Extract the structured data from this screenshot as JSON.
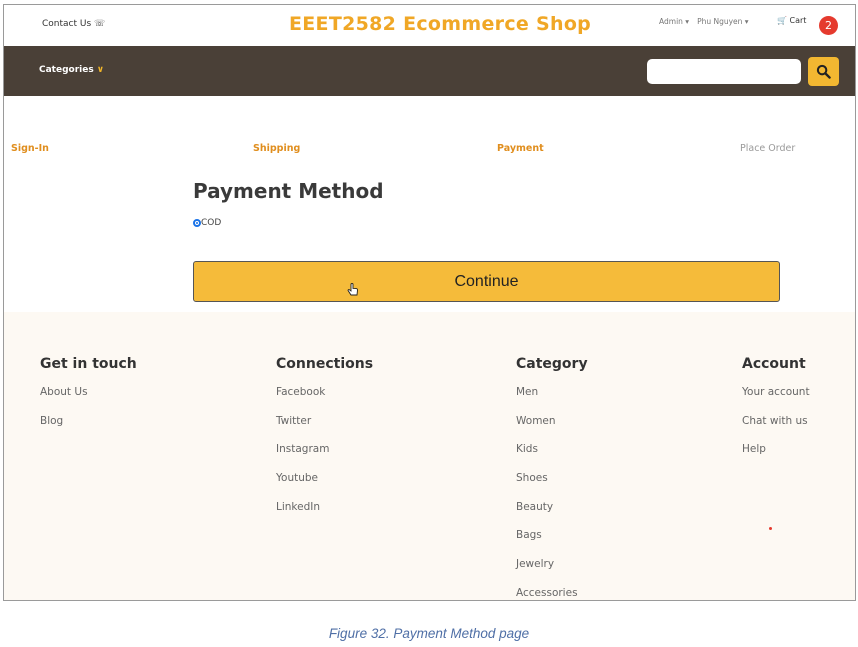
{
  "header": {
    "contact": "Contact Us",
    "brand": "EEET2582 Ecommerce Shop",
    "admin": "Admin",
    "user": "Phu Nguyen",
    "cart_label": "Cart",
    "cart_count": "2"
  },
  "nav": {
    "categories": "Categories",
    "search_placeholder": ""
  },
  "steps": [
    "Sign-In",
    "Shipping",
    "Payment",
    "Place Order"
  ],
  "payment": {
    "title": "Payment Method",
    "option_label": "COD",
    "continue_label": "Continue"
  },
  "footer": {
    "columns": [
      {
        "title": "Get in touch",
        "links": [
          "About Us",
          "Blog"
        ]
      },
      {
        "title": "Connections",
        "links": [
          "Facebook",
          "Twitter",
          "Instagram",
          "Youtube",
          "LinkedIn"
        ]
      },
      {
        "title": "Category",
        "links": [
          "Men",
          "Women",
          "Kids",
          "Shoes",
          "Beauty",
          "Bags",
          "Jewelry",
          "Accessories"
        ]
      },
      {
        "title": "Account",
        "links": [
          "Your account",
          "Chat with us",
          "Help"
        ]
      }
    ]
  },
  "caption": "Figure 32. Payment Method page",
  "colors": {
    "brand": "#f0a726",
    "navbar": "#4a4037",
    "accent": "#f5bb3a",
    "step_active": "#e08e1e",
    "badge": "#e53a2e"
  }
}
